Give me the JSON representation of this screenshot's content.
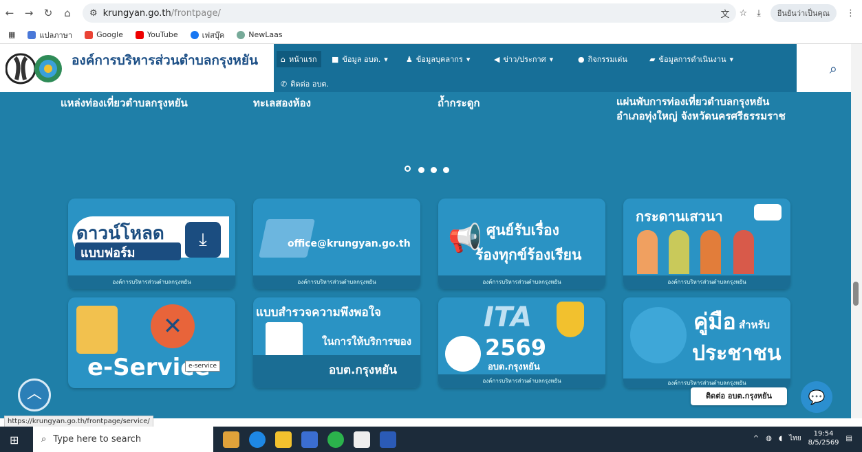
{
  "browser": {
    "url_domain": "krungyan.go.th",
    "url_path": "/frontpage/",
    "profile": "ยืนยันว่าเป็นคุณ"
  },
  "bookmarks": [
    "แปลภาษา",
    "Google",
    "YouTube",
    "เฟสบุ๊ค",
    "NewLaas"
  ],
  "site": {
    "name": "องค์การบริหารส่วนตำบลกรุงหยัน"
  },
  "menu": [
    {
      "label": "หน้าแรก",
      "icon": "home-icon"
    },
    {
      "label": "ข้อมูล อบต.",
      "icon": "book-icon"
    },
    {
      "label": "ข้อมูลบุคลากร",
      "icon": "user-icon"
    },
    {
      "label": "ข่าว/ประกาศ",
      "icon": "megaphone-icon"
    },
    {
      "label": "กิจกรรมเด่น",
      "icon": "star-icon"
    },
    {
      "label": "ข้อมูลการดำเนินงาน",
      "icon": "folder-icon"
    },
    {
      "label": "ติดต่อ อบต.",
      "icon": "phone-icon"
    }
  ],
  "slides": [
    "แหล่งท่องเที่ยวตำบลกรุงหยัน",
    "ทะเลสองห้อง",
    "ถ้ำกระดูก",
    "แผ่นพับการท่องเที่ยวตำบลกรุงหยัน อำเภอทุ่งใหญ่ จังหวัดนครศรีธรรมราช"
  ],
  "cards": [
    {
      "title": "ดาวน์โหลด",
      "sub": "แบบฟอร์ม",
      "cap": "องค์การบริหารส่วนตำบลกรุงหยัน"
    },
    {
      "title": "office@krungyan.go.th",
      "cap": "องค์การบริหารส่วนตำบลกรุงหยัน"
    },
    {
      "title": "ศูนย์รับเรื่อง",
      "sub": "ร้องทุกข์ร้องเรียน",
      "cap": "องค์การบริหารส่วนตำบลกรุงหยัน"
    },
    {
      "title": "กระดานเสวนา",
      "cap": "องค์การบริหารส่วนตำบลกรุงหยัน"
    },
    {
      "title": "e-Service",
      "tooltip": "e-service"
    },
    {
      "title": "แบบสำรวจความพึงพอใจ",
      "sub": "ในการให้บริการของ",
      "sub2": "อบต.กรุงหยัน"
    },
    {
      "title": "ITA",
      "year": "2569",
      "sub": "อบต.กรุงหยัน",
      "cap": "องค์การบริหารส่วนตำบลกรุงหยัน"
    },
    {
      "title": "คู่มือ",
      "small": "สำหรับ",
      "sub": "ประชาชน",
      "cap": "องค์การบริหารส่วนตำบลกรุงหยัน"
    }
  ],
  "contact": "ติดต่อ อบต.กรุงหยัน",
  "status_url": "https://krungyan.go.th/frontpage/service/",
  "taskbar": {
    "search_placeholder": "Type here to search",
    "time": "19:54",
    "date": "8/5/2569",
    "lang": "ไทย"
  }
}
